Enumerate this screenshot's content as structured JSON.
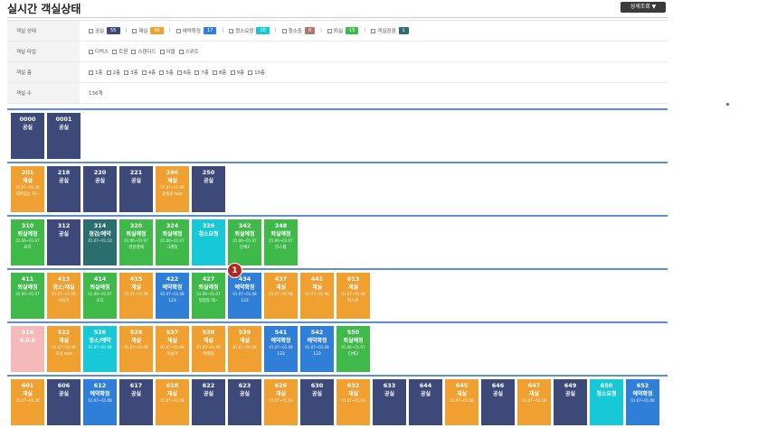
{
  "header": {
    "title": "실시간 객실상태",
    "detail_button": "상세조회 ▼"
  },
  "filters": {
    "status": {
      "label": "객실 상태",
      "options": [
        {
          "label": "공실",
          "count": "55",
          "color": "#3d4a79"
        },
        {
          "label": "재실",
          "count": "90",
          "color": "#f0a030"
        },
        {
          "label": "예약확정",
          "count": "17",
          "color": "#2f7fd9"
        },
        {
          "label": "청소요청",
          "count": "10",
          "color": "#17c9d6"
        },
        {
          "label": "청소중",
          "count": "0",
          "color": "#b0786a"
        },
        {
          "label": "퇴실",
          "count": "15",
          "color": "#3fb94a"
        },
        {
          "label": "객실점검",
          "count": "1",
          "color": "#2a6e70"
        }
      ]
    },
    "type": {
      "label": "객실 타입",
      "options": [
        "디럭스",
        "트윈",
        "스탠다드",
        "더블",
        "스위트"
      ]
    },
    "floor": {
      "label": "객실 층",
      "options": [
        "1층",
        "2층",
        "3층",
        "4층",
        "5층",
        "6층",
        "7층",
        "8층",
        "9층",
        "10층"
      ]
    },
    "count": {
      "label": "객실 수",
      "value": "136개"
    }
  },
  "floors": [
    [
      {
        "no": "0000",
        "status": "공실",
        "date": "",
        "guest": "",
        "color": "#3d4a79"
      },
      {
        "no": "0001",
        "status": "공실",
        "date": "",
        "guest": "",
        "color": "#3d4a79"
      }
    ],
    [
      {
        "no": "201",
        "status": "재실",
        "date": "01.07~01.30",
        "guest": "재미있는 테~",
        "color": "#f0a030"
      },
      {
        "no": "218",
        "status": "공실",
        "date": "",
        "guest": "",
        "color": "#3d4a79"
      },
      {
        "no": "220",
        "status": "공실",
        "date": "",
        "guest": "",
        "color": "#3d4a79"
      },
      {
        "no": "221",
        "status": "공실",
        "date": "",
        "guest": "",
        "color": "#3d4a79"
      },
      {
        "no": "240",
        "status": "재실",
        "date": "01.07~01.08",
        "guest": "윤동준 test",
        "color": "#f0a030"
      },
      {
        "no": "250",
        "status": "공실",
        "date": "",
        "guest": "",
        "color": "#3d4a79"
      }
    ],
    [
      {
        "no": "310",
        "status": "퇴실예정",
        "date": "01.06~01.07",
        "guest": "오다",
        "color": "#3fb94a"
      },
      {
        "no": "312",
        "status": "공실",
        "date": "",
        "guest": "",
        "color": "#3d4a79"
      },
      {
        "no": "314",
        "status": "점검/예약",
        "date": "01.07~01.10",
        "guest": ".",
        "color": "#2a6e70"
      },
      {
        "no": "320",
        "status": "퇴실예정",
        "date": "01.06~01.07",
        "guest": "한강결제",
        "color": "#3fb94a"
      },
      {
        "no": "324",
        "status": "퇴실예정",
        "date": "01.06~01.07",
        "guest": "그래밍",
        "color": "#3fb94a"
      },
      {
        "no": "326",
        "status": "청소요청",
        "date": "",
        "guest": "",
        "color": "#17c9d6"
      },
      {
        "no": "342",
        "status": "퇴실예정",
        "date": "01.06~01.07",
        "guest": "단체2",
        "color": "#3fb94a"
      },
      {
        "no": "348",
        "status": "퇴실예정",
        "date": "01.06~01.07",
        "guest": "터스톨",
        "color": "#3fb94a"
      }
    ],
    [
      {
        "no": "411",
        "status": "퇴실예정",
        "date": "01.06~01.07",
        "guest": ".",
        "color": "#3fb94a"
      },
      {
        "no": "413",
        "status": "청소/재실",
        "date": "01.07~01.08",
        "guest": "이성겨",
        "color": "#f0a030"
      },
      {
        "no": "414",
        "status": "퇴실예정",
        "date": "01.06~01.07",
        "guest": "오디",
        "color": "#3fb94a"
      },
      {
        "no": "415",
        "status": "재실",
        "date": "01.07~01.08",
        "guest": ".",
        "color": "#f0a030"
      },
      {
        "no": "422",
        "status": "예약확정",
        "date": "01.07~01.08",
        "guest": "123",
        "color": "#2f7fd9"
      },
      {
        "no": "427",
        "status": "퇴실예정",
        "date": "01.06~01.07",
        "guest": "일정등 테~",
        "color": "#3fb94a"
      },
      {
        "no": "434",
        "status": "예약확정",
        "date": "01.07~01.08",
        "guest": "123",
        "color": "#2f7fd9"
      },
      {
        "no": "437",
        "status": "재실",
        "date": "01.07~01.08",
        "guest": ".",
        "color": "#f0a030"
      },
      {
        "no": "441",
        "status": "재실",
        "date": "01.07~01.08",
        "guest": ".",
        "color": "#f0a030"
      },
      {
        "no": "613",
        "status": "재실",
        "date": "01.07~01.08",
        "guest": "터스트",
        "color": "#f0a030"
      }
    ],
    [
      {
        "no": "516",
        "status": "0.0.0",
        "date": "",
        "guest": "",
        "color": "#f6b9b9"
      },
      {
        "no": "522",
        "status": "재실",
        "date": "01.07~01.08",
        "guest": "조식 test",
        "color": "#f0a030"
      },
      {
        "no": "526",
        "status": "청소/예약",
        "date": "01.07~01.08",
        "guest": ".",
        "color": "#17c9d6"
      },
      {
        "no": "528",
        "status": "재실",
        "date": "01.07~01.08",
        "guest": ".",
        "color": "#f0a030"
      },
      {
        "no": "537",
        "status": "재실",
        "date": "01.07~01.08",
        "guest": "이성겨",
        "color": "#f0a030"
      },
      {
        "no": "538",
        "status": "재실",
        "date": "01.07~01.08",
        "guest": "여행링",
        "color": "#f0a030"
      },
      {
        "no": "539",
        "status": "재실",
        "date": "01.07~01.08",
        "guest": ".",
        "color": "#f0a030"
      },
      {
        "no": "541",
        "status": "예약확정",
        "date": "01.07~01.08",
        "guest": "123",
        "color": "#2f7fd9"
      },
      {
        "no": "542",
        "status": "예약확정",
        "date": "01.07~01.08",
        "guest": "123",
        "color": "#2f7fd9"
      },
      {
        "no": "550",
        "status": "퇴실예정",
        "date": "01.06~01.07",
        "guest": "단체2",
        "color": "#3fb94a"
      }
    ],
    [
      {
        "no": "601",
        "status": "재실",
        "date": "01.07~01.30",
        "guest": "",
        "color": "#f0a030"
      },
      {
        "no": "606",
        "status": "공실",
        "date": "",
        "guest": "",
        "color": "#3d4a79"
      },
      {
        "no": "612",
        "status": "예약확정",
        "date": "01.07~01.08",
        "guest": "",
        "color": "#2f7fd9"
      },
      {
        "no": "617",
        "status": "공실",
        "date": "",
        "guest": "",
        "color": "#3d4a79"
      },
      {
        "no": "618",
        "status": "재실",
        "date": "01.07~01.08",
        "guest": "",
        "color": "#f0a030"
      },
      {
        "no": "622",
        "status": "공실",
        "date": "",
        "guest": "",
        "color": "#3d4a79"
      },
      {
        "no": "623",
        "status": "공실",
        "date": "",
        "guest": "",
        "color": "#3d4a79"
      },
      {
        "no": "626",
        "status": "재실",
        "date": "01.07~01.16",
        "guest": "",
        "color": "#f0a030"
      },
      {
        "no": "630",
        "status": "공실",
        "date": "",
        "guest": "",
        "color": "#3d4a79"
      },
      {
        "no": "632",
        "status": "재실",
        "date": "01.07~01.18",
        "guest": "",
        "color": "#f0a030"
      },
      {
        "no": "633",
        "status": "공실",
        "date": "",
        "guest": "",
        "color": "#3d4a79"
      },
      {
        "no": "644",
        "status": "공실",
        "date": "",
        "guest": "",
        "color": "#3d4a79"
      },
      {
        "no": "645",
        "status": "재실",
        "date": "01.07~01.08",
        "guest": "",
        "color": "#f0a030"
      },
      {
        "no": "646",
        "status": "공실",
        "date": "",
        "guest": "",
        "color": "#3d4a79"
      },
      {
        "no": "647",
        "status": "재실",
        "date": "01.07~03.18",
        "guest": "",
        "color": "#f0a030"
      },
      {
        "no": "649",
        "status": "공실",
        "date": "",
        "guest": "",
        "color": "#3d4a79"
      },
      {
        "no": "650",
        "status": "청소요청",
        "date": "",
        "guest": "",
        "color": "#17c9d6"
      },
      {
        "no": "652",
        "status": "예약확정",
        "date": "01.07~01.08",
        "guest": "",
        "color": "#2f7fd9"
      }
    ]
  ],
  "marker": {
    "label": "1"
  }
}
